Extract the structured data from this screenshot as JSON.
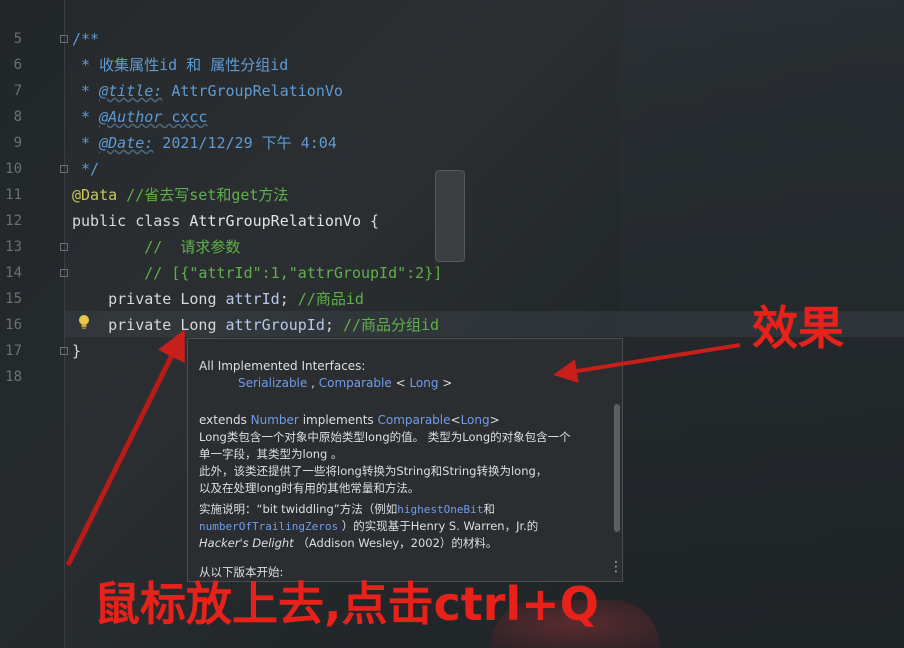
{
  "gutter": {
    "line_numbers": [
      "5",
      "6",
      "7",
      "8",
      "9",
      "10",
      "11",
      "12",
      "13",
      "14",
      "15",
      "16",
      "17",
      "18"
    ]
  },
  "code": {
    "l5": "/**",
    "l6": " * 收集属性id 和 属性分组id",
    "l7_prefix": " * ",
    "l7_tag": "@title:",
    "l7_value": " AttrGroupRelationVo",
    "l8_prefix": " * ",
    "l8_tag": "@Author",
    "l8_value": " cxcc",
    "l9_prefix": " * ",
    "l9_tag": "@Date:",
    "l9_value": " 2021/12/29 下午 4:04",
    "l10": " */",
    "l11_anno": "@Data",
    "l11_comment": " //省去写set和get方法",
    "l12_kw": "public class ",
    "l12_name": "AttrGroupRelationVo",
    "l12_rest": " {",
    "l13": "        //  请求参数",
    "l14": "        // [{\"attrId\":1,\"attrGroupId\":2}]",
    "l15_kw": "    private ",
    "l15_type": "Long ",
    "l15_field": "attrId",
    "l15_semi": "; ",
    "l15_comment": "//商品id",
    "l16_kw": "    private ",
    "l16_type": "Long ",
    "l16_field": "attrGroupId",
    "l16_semi": "; ",
    "l16_comment": "//商品分组id",
    "l17": "}"
  },
  "popup": {
    "implemented_header": "All Implemented Interfaces:",
    "iface1": "Serializable",
    "iface_sep": " , ",
    "iface2": "Comparable",
    "iface2_open": " < ",
    "iface2_arg": "Long",
    "iface2_close": " >",
    "extends_kw": "extends ",
    "extends_cls": "Number",
    "implements_kw": " implements ",
    "implements_cls": "Comparable",
    "implements_lt": "<",
    "implements_arg": "Long",
    "implements_gt": ">",
    "desc1": "Long类包含一个对象中原始类型long的值。 类型为Long的对象包含一个",
    "desc2": "单一字段，其类型为long 。",
    "desc3": "此外，该类还提供了一些将long转换为String和String转换为long，",
    "desc4": "以及在处理long时有用的其他常量和方法。",
    "note_a": "实施说明：“bit twiddling”方法（例如",
    "note_link1": "highestOneBit",
    "note_b": "和",
    "note_link2": "numberOfTrailingZeros",
    "note_c": " ）的实现基于Henry S. Warren，Jr.的",
    "note_book": "Hacker's Delight",
    "note_d": " （Addison Wesley，2002）的材料。",
    "since_label": "从以下版本开始:",
    "menu_icon": "⋮"
  },
  "annotations": {
    "effect_label": "效果",
    "hint_label": "鼠标放上去,点击ctrl+Q",
    "color": "#e8221b"
  }
}
